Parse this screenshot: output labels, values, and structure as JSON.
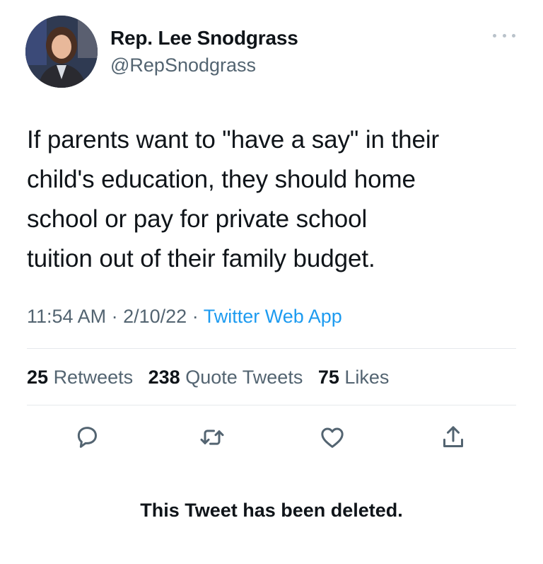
{
  "author": {
    "display_name": "Rep. Lee Snodgrass",
    "handle": "@RepSnodgrass",
    "avatar_icon": "profile-photo"
  },
  "tweet": {
    "text_lines": [
      "If parents want to \"have a say\" in their",
      "child's education, they should home",
      "school or pay for private school",
      "tuition out of their family budget."
    ],
    "time": "11:54 AM",
    "date": "2/10/22",
    "separator": "·",
    "source": "Twitter Web App"
  },
  "stats": {
    "retweets_count": "25",
    "retweets_label": "Retweets",
    "quotes_count": "238",
    "quotes_label": "Quote Tweets",
    "likes_count": "75",
    "likes_label": "Likes"
  },
  "actions": [
    "reply-icon",
    "retweet-icon",
    "like-icon",
    "share-icon"
  ],
  "status_message": "This Tweet has been deleted.",
  "colors": {
    "text": "#0f1419",
    "secondary": "#536471",
    "link": "#1d9bf0",
    "divider": "#e6e9ec"
  }
}
